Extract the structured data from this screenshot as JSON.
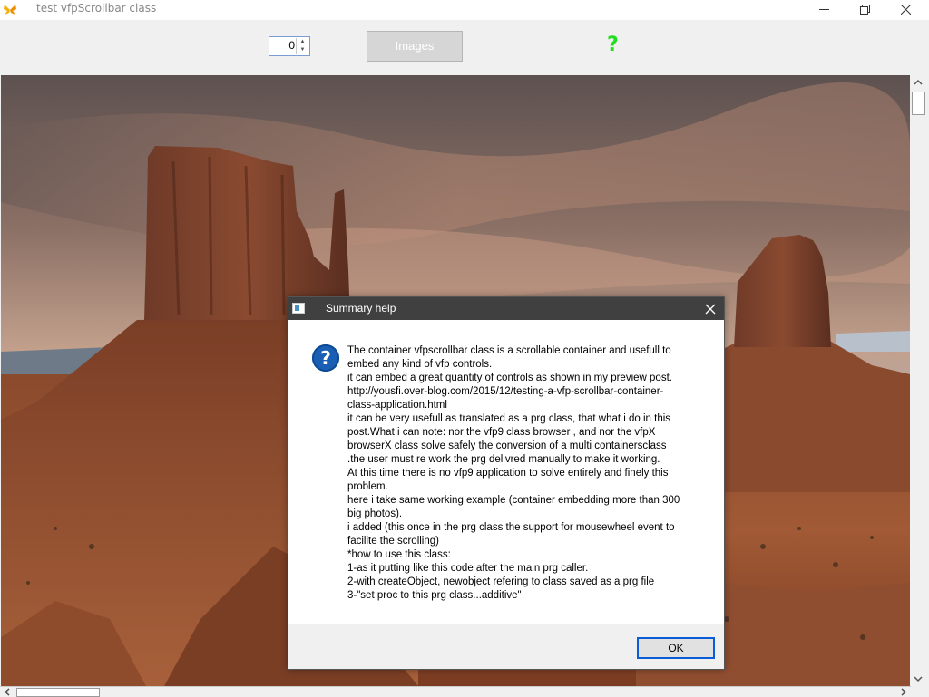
{
  "window": {
    "title": "test vfpScrollbar class",
    "app_icon": "butterfly-icon"
  },
  "toolbar": {
    "spinner_value": "0",
    "images_label": "Images",
    "help_label": "?"
  },
  "dialog": {
    "title": "Summary help",
    "icon": "question-icon",
    "lines": [
      "The container  vfpscrollbar class is a scrollable container and usefull to",
      "embed any kind of vfp controls.",
      "it can embed a great quantity of controls as shown in my preview post.",
      "http://yousfi.over-blog.com/2015/12/testing-a-vfp-scrollbar-container-",
      "class-application.html",
      "it can be very usefull as translated as a prg class, that what i do in this",
      "post.What i can note: nor the vfp9 class browser , and nor the vfpX",
      "browserX class solve safely the conversion of a  multi containersclass",
      ".the user must re work the prg delivred manually to make it working.",
      "At this time  there is no  vfp9 application to solve entirely and finely this",
      "problem.",
      "here i take same working example (container embedding more than 300",
      "big photos).",
      "i added (this once in the prg class the support for mousewheel event to",
      "facilite the scrolling)",
      "*how to use this class:",
      "1-as it putting like this code after the main prg caller.",
      "2-with createObject, newobject refering to class saved as a prg file",
      "3-\"set proc to this prg class...additive\""
    ],
    "ok_label": "OK"
  }
}
